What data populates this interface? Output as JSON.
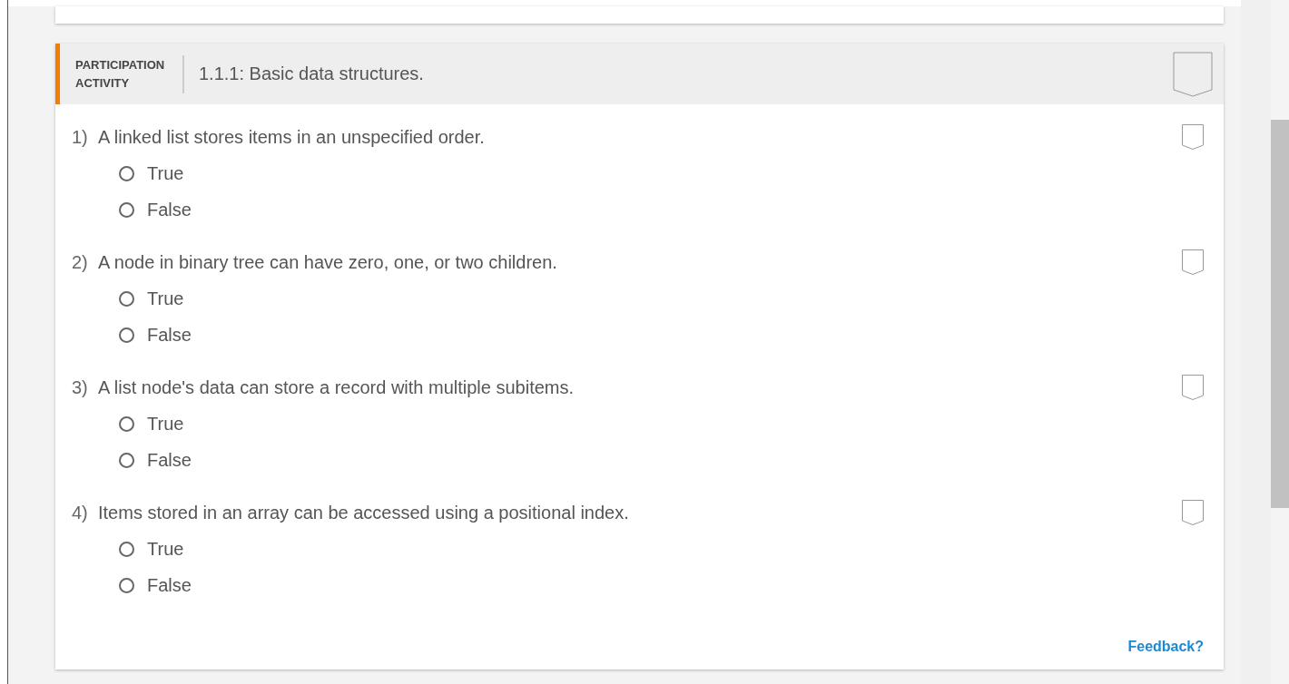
{
  "activity": {
    "label": "PARTICIPATION ACTIVITY",
    "title": "1.1.1: Basic data structures."
  },
  "questions": [
    {
      "number": "1)",
      "text": "A linked list stores items in an unspecified order.",
      "options": [
        {
          "label": "True",
          "selected": false
        },
        {
          "label": "False",
          "selected": false
        }
      ]
    },
    {
      "number": "2)",
      "text": "A node in binary tree can have zero, one, or two children.",
      "options": [
        {
          "label": "True",
          "selected": false
        },
        {
          "label": "False",
          "selected": false
        }
      ]
    },
    {
      "number": "3)",
      "text": "A list node's data can store a record with multiple subitems.",
      "options": [
        {
          "label": "True",
          "selected": false
        },
        {
          "label": "False",
          "selected": false
        }
      ]
    },
    {
      "number": "4)",
      "text": "Items stored in an array can be accessed using a positional index.",
      "options": [
        {
          "label": "True",
          "selected": false
        },
        {
          "label": "False",
          "selected": false
        }
      ]
    }
  ],
  "feedback_link": "Feedback?"
}
